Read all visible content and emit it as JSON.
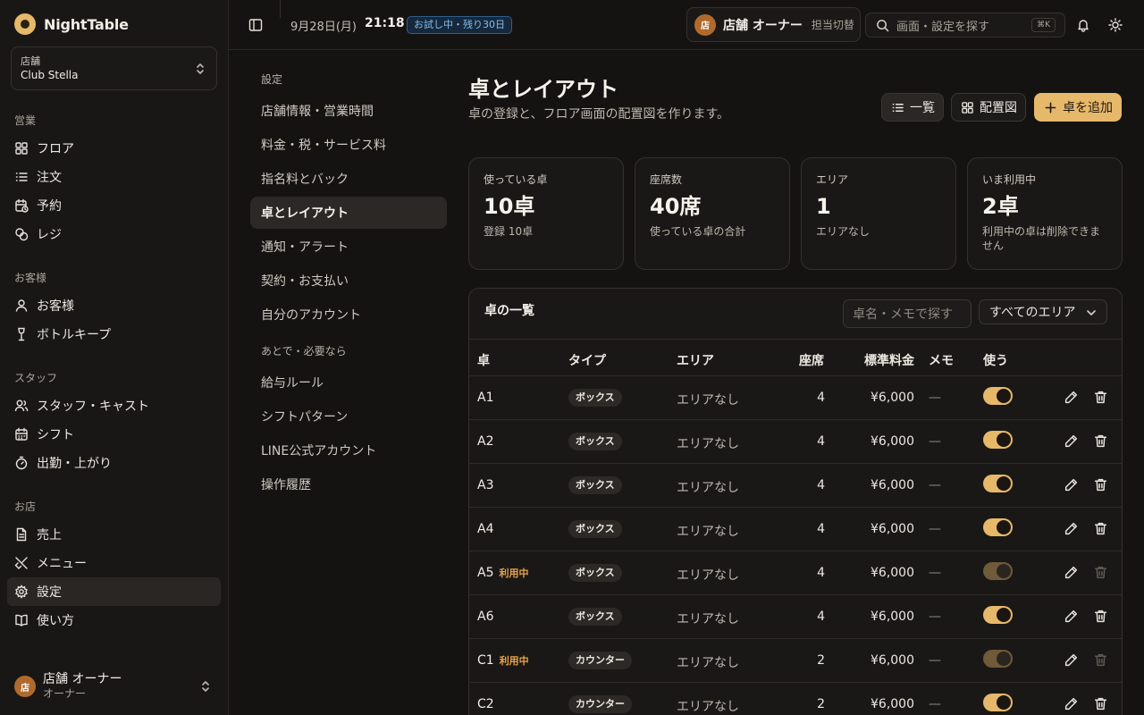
{
  "brand": {
    "name": "NightTable"
  },
  "store": {
    "label": "店舗",
    "name": "Club Stella"
  },
  "sidebar": {
    "sections": [
      {
        "title": "営業",
        "items": [
          {
            "label": "フロア",
            "icon": "floor-grid-icon"
          },
          {
            "label": "注文",
            "icon": "order-list-icon"
          },
          {
            "label": "予約",
            "icon": "reservation-calendar-icon"
          },
          {
            "label": "レジ",
            "icon": "register-coins-icon"
          }
        ]
      },
      {
        "title": "お客様",
        "items": [
          {
            "label": "お客様",
            "icon": "customer-user-icon"
          },
          {
            "label": "ボトルキープ",
            "icon": "bottle-keep-icon"
          }
        ]
      },
      {
        "title": "スタッフ",
        "items": [
          {
            "label": "スタッフ・キャスト",
            "icon": "staff-users-icon"
          },
          {
            "label": "シフト",
            "icon": "shift-calendar-icon"
          },
          {
            "label": "出勤・上がり",
            "icon": "attendance-timer-icon"
          }
        ]
      },
      {
        "title": "お店",
        "items": [
          {
            "label": "売上",
            "icon": "sales-document-icon"
          },
          {
            "label": "メニュー",
            "icon": "menu-utensils-icon"
          },
          {
            "label": "設定",
            "icon": "settings-gear-icon",
            "active": true
          },
          {
            "label": "使い方",
            "icon": "guide-book-icon"
          }
        ]
      }
    ]
  },
  "user": {
    "avatar": "店",
    "name": "店舗 オーナー",
    "role": "オーナー"
  },
  "topbar": {
    "date": "9月28日(月)",
    "time": "21:18",
    "trial_badge": "お試し中・残り30日",
    "staff_avatar": "店",
    "staff_name": "店舗 オーナー",
    "staff_switch": "担当切替",
    "search_placeholder": "画面・設定を探す",
    "search_shortcut": "⌘K"
  },
  "settings_nav": {
    "title": "設定",
    "items": [
      "店舗情報・営業時間",
      "料金・税・サービス料",
      "指名料とバック",
      "卓とレイアウト",
      "通知・アラート",
      "契約・お支払い",
      "自分のアカウント"
    ],
    "active": "卓とレイアウト",
    "secondary_title": "あとで・必要なら",
    "secondary_items": [
      "給与ルール",
      "シフトパターン",
      "LINE公式アカウント",
      "操作履歴"
    ]
  },
  "page": {
    "title": "卓とレイアウト",
    "subtitle": "卓の登録と、フロア画面の配置図を作ります。",
    "btn_list": "一覧",
    "btn_layout": "配置図",
    "btn_add": "卓を追加"
  },
  "stats": [
    {
      "label": "使っている卓",
      "value": "10卓",
      "sub": "登録 10卓"
    },
    {
      "label": "座席数",
      "value": "40席",
      "sub": "使っている卓の合計"
    },
    {
      "label": "エリア",
      "value": "1",
      "sub": "エリアなし"
    },
    {
      "label": "いま利用中",
      "value": "2卓",
      "sub": "利用中の卓は削除できません"
    }
  ],
  "table": {
    "title": "卓の一覧",
    "search_placeholder": "卓名・メモで探す",
    "filter": "すべてのエリア",
    "columns": [
      "卓",
      "タイプ",
      "エリア",
      "座席",
      "標準料金",
      "メモ",
      "使う"
    ],
    "in_use_label": "利用中",
    "rows": [
      {
        "name": "A1",
        "in_use": false,
        "type": "ボックス",
        "area": "エリアなし",
        "seats": "4",
        "price": "¥6,000",
        "memo": "—",
        "enabled": true
      },
      {
        "name": "A2",
        "in_use": false,
        "type": "ボックス",
        "area": "エリアなし",
        "seats": "4",
        "price": "¥6,000",
        "memo": "—",
        "enabled": true
      },
      {
        "name": "A3",
        "in_use": false,
        "type": "ボックス",
        "area": "エリアなし",
        "seats": "4",
        "price": "¥6,000",
        "memo": "—",
        "enabled": true
      },
      {
        "name": "A4",
        "in_use": false,
        "type": "ボックス",
        "area": "エリアなし",
        "seats": "4",
        "price": "¥6,000",
        "memo": "—",
        "enabled": true
      },
      {
        "name": "A5",
        "in_use": true,
        "type": "ボックス",
        "area": "エリアなし",
        "seats": "4",
        "price": "¥6,000",
        "memo": "—",
        "enabled": true
      },
      {
        "name": "A6",
        "in_use": false,
        "type": "ボックス",
        "area": "エリアなし",
        "seats": "4",
        "price": "¥6,000",
        "memo": "—",
        "enabled": true
      },
      {
        "name": "C1",
        "in_use": true,
        "type": "カウンター",
        "area": "エリアなし",
        "seats": "2",
        "price": "¥6,000",
        "memo": "—",
        "enabled": true
      },
      {
        "name": "C2",
        "in_use": false,
        "type": "カウンター",
        "area": "エリアなし",
        "seats": "2",
        "price": "¥6,000",
        "memo": "—",
        "enabled": true
      }
    ]
  },
  "colors": {
    "accent": "#e6b86a",
    "in_use": "#e7a24a",
    "trial": "#86bff0",
    "background": "#151311"
  }
}
